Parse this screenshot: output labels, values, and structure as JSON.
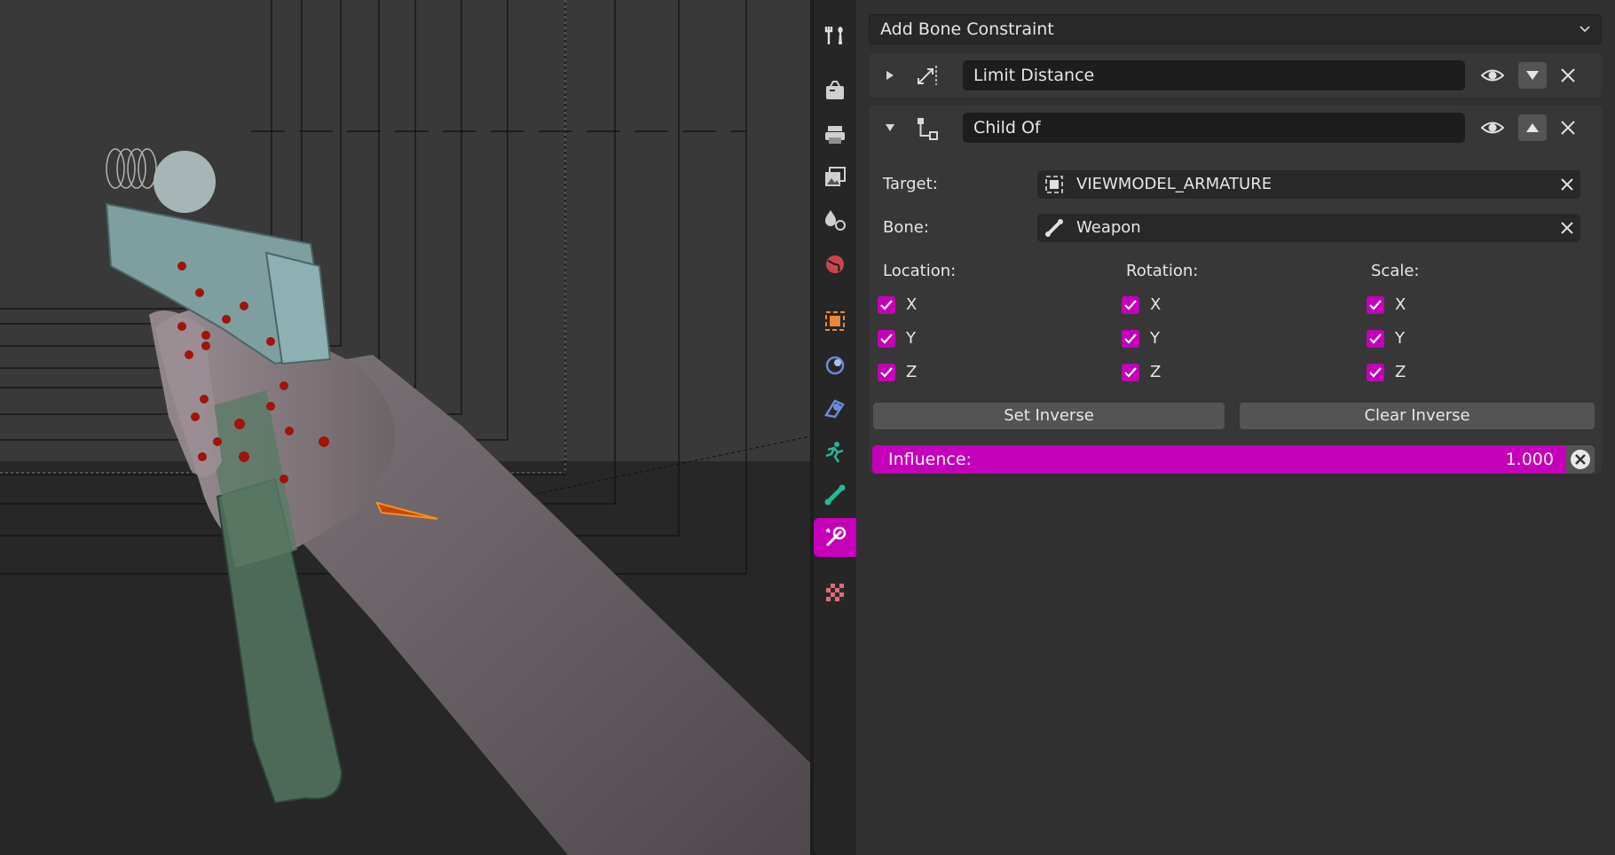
{
  "viewport": {
    "description_icon": "3d-viewport-scene"
  },
  "tabs": [
    {
      "name": "tool-tab",
      "icon": "tool-icon",
      "active": false
    },
    {
      "name": "render-tab",
      "icon": "render-icon",
      "active": false
    },
    {
      "name": "output-tab",
      "icon": "output-icon",
      "active": false
    },
    {
      "name": "view-layer-tab",
      "icon": "view-layer-icon",
      "active": false
    },
    {
      "name": "scene-tab",
      "icon": "scene-icon",
      "active": false
    },
    {
      "name": "world-tab",
      "icon": "world-icon",
      "active": false
    },
    {
      "name": "object-tab",
      "icon": "object-icon",
      "active": false
    },
    {
      "name": "modifiers-tab",
      "icon": "modifiers-icon",
      "active": false
    },
    {
      "name": "particles-tab",
      "icon": "particles-icon",
      "active": false
    },
    {
      "name": "physics-tab",
      "icon": "physics-icon",
      "active": false
    },
    {
      "name": "object-data-tab",
      "icon": "armature-icon",
      "active": false
    },
    {
      "name": "bone-tab",
      "icon": "bone-icon",
      "active": false
    },
    {
      "name": "bone-constraint-tab",
      "icon": "bone-constraint-icon",
      "active": true
    },
    {
      "name": "texture-tab",
      "icon": "texture-icon",
      "active": false
    }
  ],
  "panel": {
    "add_constraint": "Add Bone Constraint",
    "constraints": [
      {
        "name": "Limit Distance",
        "expanded": false,
        "icon": "limit-distance-icon"
      },
      {
        "name": "Child Of",
        "expanded": true,
        "icon": "child-of-icon",
        "target_label": "Target:",
        "target_value": "VIEWMODEL_ARMATURE",
        "bone_label": "Bone:",
        "bone_value": "Weapon",
        "location_label": "Location:",
        "rotation_label": "Rotation:",
        "scale_label": "Scale:",
        "axes": [
          "X",
          "Y",
          "Z"
        ],
        "set_inverse": "Set Inverse",
        "clear_inverse": "Clear Inverse",
        "influence_label": "Influence:",
        "influence_value": "1.000"
      }
    ]
  },
  "colors": {
    "accent": "#c400b8",
    "panel_bg": "#303030",
    "box_bg": "#373737",
    "field_bg": "#282828"
  }
}
